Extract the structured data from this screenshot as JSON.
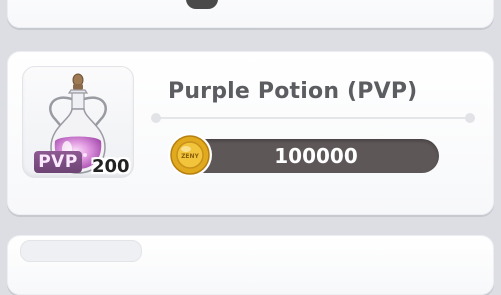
{
  "item": {
    "name": "Purple Potion (PVP)",
    "badge": "PVP",
    "quantity": "200",
    "icon": "purple-potion-icon"
  },
  "price": {
    "currency_icon": "zeny-coin-icon",
    "coin_label": "ZENY",
    "amount": "100000"
  },
  "colors": {
    "background": "#dcdee3",
    "card": "#ffffff",
    "title": "#5c5d61",
    "price_bar": "#5e5758",
    "badge": "#7a4d80",
    "potion": "#d98bd9",
    "coin": "#e0a91e"
  }
}
